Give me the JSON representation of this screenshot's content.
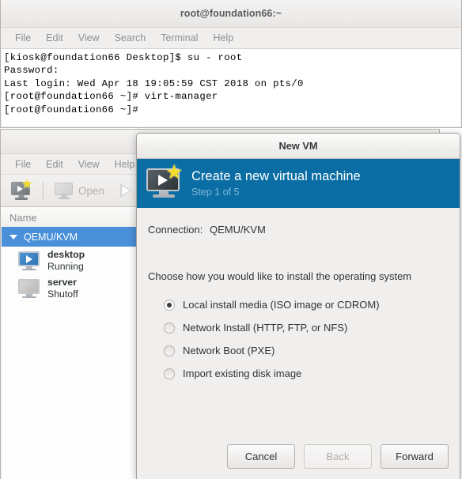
{
  "terminal": {
    "title": "root@foundation66:~",
    "menu": [
      "File",
      "Edit",
      "View",
      "Search",
      "Terminal",
      "Help"
    ],
    "lines": [
      "[kiosk@foundation66 Desktop]$ su - root",
      "Password:",
      "Last login: Wed Apr 18 19:05:59 CST 2018 on pts/0",
      "[root@foundation66 ~]# virt-manager",
      "[root@foundation66 ~]#"
    ]
  },
  "virt_manager": {
    "menu": [
      "File",
      "Edit",
      "View",
      "Help"
    ],
    "toolbar": {
      "new_vm_icon": "new-vm-monitor-icon",
      "open_label": "Open",
      "run_icon": "play-triangle-icon"
    },
    "list_header": "Name",
    "connection": {
      "name": "QEMU/KVM",
      "expander": "triangle-down-icon"
    },
    "vms": [
      {
        "name": "desktop",
        "state": "Running",
        "icon": "monitor-running-icon"
      },
      {
        "name": "server",
        "state": "Shutoff",
        "icon": "monitor-shutoff-icon"
      }
    ]
  },
  "new_vm_dialog": {
    "window_title": "New VM",
    "banner": {
      "title": "Create a new virtual machine",
      "step": "Step 1 of 5",
      "icon": "new-vm-monitor-icon"
    },
    "connection_label": "Connection:",
    "connection_value": "QEMU/KVM",
    "choose_label": "Choose how you would like to install the operating system",
    "install_options": [
      {
        "label": "Local install media (ISO image or CDROM)",
        "selected": true
      },
      {
        "label": "Network Install (HTTP, FTP, or NFS)",
        "selected": false
      },
      {
        "label": "Network Boot (PXE)",
        "selected": false
      },
      {
        "label": "Import existing disk image",
        "selected": false
      }
    ],
    "buttons": {
      "cancel": "Cancel",
      "back": "Back",
      "forward": "Forward"
    }
  },
  "colors": {
    "banner_blue": "#0a6ea5",
    "selection_blue": "#4a90d9",
    "chrome_gray": "#f0efee",
    "terminal_bg": "#ffffff",
    "terminal_fg": "#000000",
    "star_yellow": "#f5dd2a"
  }
}
